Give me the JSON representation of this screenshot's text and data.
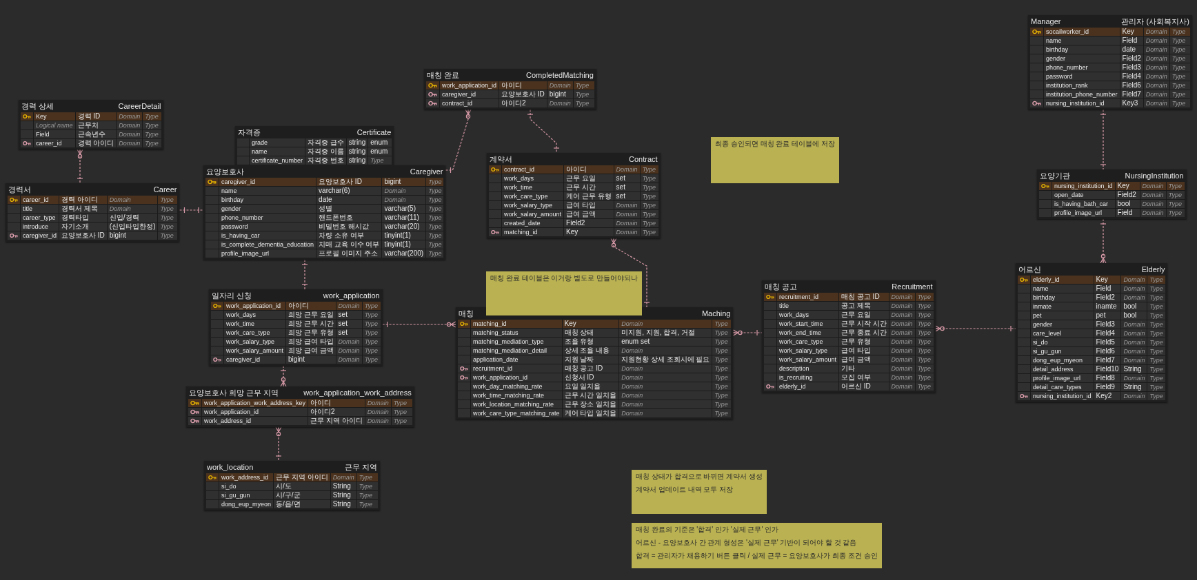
{
  "tables": [
    {
      "title_left": "경력 상세",
      "title_right": "CareerDetail",
      "rows": [
        {
          "kind": "primary_key",
          "cells": [
            "Key",
            "경력 ID",
            {
              "placeholder": "Domain"
            },
            {
              "placeholder": "Type"
            }
          ]
        },
        {
          "kind": "field",
          "cells": [
            {
              "placeholder": "Logical name"
            },
            "근무처",
            {
              "placeholder": "Domain"
            },
            {
              "placeholder": "Type"
            }
          ]
        },
        {
          "kind": "field",
          "cells": [
            "Field",
            "근속년수",
            {
              "placeholder": "Domain"
            },
            {
              "placeholder": "Type"
            }
          ]
        },
        {
          "kind": "foreign_key",
          "cells": [
            "career_id",
            "경력 아이디",
            {
              "placeholder": "Domain"
            },
            {
              "placeholder": "Type"
            }
          ]
        }
      ]
    },
    {
      "title_left": "경력서",
      "title_right": "Career",
      "rows": [
        {
          "kind": "primary_key",
          "cells": [
            "career_id",
            "경력 아이디",
            {
              "placeholder": "Domain"
            },
            {
              "placeholder": "Type"
            }
          ]
        },
        {
          "kind": "field",
          "cells": [
            "title",
            "경력서 제목",
            {
              "placeholder": "Domain"
            },
            {
              "placeholder": "Type"
            }
          ]
        },
        {
          "kind": "field",
          "cells": [
            "career_type",
            "경력타입",
            "신입/경력",
            {
              "placeholder": "Type"
            }
          ]
        },
        {
          "kind": "field",
          "cells": [
            "introduce",
            "자기소개",
            "(신입타입한정)",
            {
              "placeholder": "Type"
            }
          ]
        },
        {
          "kind": "foreign_key",
          "cells": [
            "caregiver_id",
            "요양보호사 ID",
            "bigint",
            {
              "placeholder": "Type"
            }
          ]
        }
      ]
    },
    {
      "title_left": "자격증",
      "title_right": "Certificate",
      "rows": [
        {
          "kind": "field",
          "cells": [
            "grade",
            "자격증 급수",
            "string",
            "enum"
          ]
        },
        {
          "kind": "field",
          "cells": [
            "name",
            "자격증 이름",
            "string",
            "enum"
          ]
        },
        {
          "kind": "field",
          "cells": [
            "certificate_number",
            "자격증 번호",
            "string",
            {
              "placeholder": "Type"
            }
          ]
        }
      ]
    },
    {
      "title_left": "요양보호사",
      "title_right": "Caregiver",
      "rows": [
        {
          "kind": "primary_key",
          "cells": [
            "caregiver_id",
            "요양보호사 ID",
            "bigint",
            {
              "placeholder": "Type"
            }
          ]
        },
        {
          "kind": "field",
          "cells": [
            "name",
            "varchar(6)",
            {
              "placeholder": "Domain"
            },
            {
              "placeholder": "Type"
            }
          ]
        },
        {
          "kind": "field",
          "cells": [
            "birthday",
            "date",
            {
              "placeholder": "Domain"
            },
            {
              "placeholder": "Type"
            }
          ]
        },
        {
          "kind": "field",
          "cells": [
            "gender",
            "성별",
            "varchar(5)",
            {
              "placeholder": "Type"
            }
          ]
        },
        {
          "kind": "field",
          "cells": [
            "phone_number",
            "핸드폰번호",
            "varchar(11)",
            {
              "placeholder": "Type"
            }
          ]
        },
        {
          "kind": "field",
          "cells": [
            "password",
            "비밀번호 해시값",
            "varchar(20)",
            {
              "placeholder": "Type"
            }
          ]
        },
        {
          "kind": "field",
          "cells": [
            "is_having_car",
            "차량 소유 여부",
            "tinyint(1)",
            {
              "placeholder": "Type"
            }
          ]
        },
        {
          "kind": "field",
          "cells": [
            "is_complete_dementia_education",
            "치매 교육 이수 여부",
            "tinyint(1)",
            {
              "placeholder": "Type"
            }
          ]
        },
        {
          "kind": "field",
          "cells": [
            "profile_image_url",
            "프로필 이미지 주소",
            "varchar(200)",
            {
              "placeholder": "Type"
            }
          ]
        }
      ]
    },
    {
      "title_left": "일자리 신청",
      "title_right": "work_application",
      "rows": [
        {
          "kind": "primary_key",
          "cells": [
            "work_application_id",
            "아이디",
            {
              "placeholder": "Domain"
            },
            {
              "placeholder": "Type"
            }
          ]
        },
        {
          "kind": "field",
          "cells": [
            "work_days",
            "희망 근무 요일",
            "set",
            {
              "placeholder": "Type"
            }
          ]
        },
        {
          "kind": "field",
          "cells": [
            "work_time",
            "희망 근무 시간",
            "set",
            {
              "placeholder": "Type"
            }
          ]
        },
        {
          "kind": "field",
          "cells": [
            "work_care_type",
            "희망 근무 유형",
            "set",
            {
              "placeholder": "Type"
            }
          ]
        },
        {
          "kind": "field",
          "cells": [
            "work_salary_type",
            "희망 급여 타입",
            {
              "placeholder": "Domain"
            },
            {
              "placeholder": "Type"
            }
          ]
        },
        {
          "kind": "field",
          "cells": [
            "work_salary_amount",
            "희망 급여 금액",
            {
              "placeholder": "Domain"
            },
            {
              "placeholder": "Type"
            }
          ]
        },
        {
          "kind": "foreign_key",
          "cells": [
            "caregiver_id",
            "bigint",
            {
              "placeholder": "Domain"
            },
            {
              "placeholder": "Type"
            }
          ]
        }
      ]
    },
    {
      "title_left": "요양보호사 희망 근무 지역",
      "title_right": "work_application_work_address",
      "rows": [
        {
          "kind": "primary_key",
          "cells": [
            "work_application_work_address_key",
            "아이디",
            {
              "placeholder": "Domain"
            },
            {
              "placeholder": "Type"
            }
          ]
        },
        {
          "kind": "foreign_key",
          "cells": [
            "work_application_id",
            "아이디2",
            {
              "placeholder": "Domain"
            },
            {
              "placeholder": "Type"
            }
          ]
        },
        {
          "kind": "foreign_key",
          "cells": [
            "work_address_id",
            "근무 지역 아이디",
            {
              "placeholder": "Domain"
            },
            {
              "placeholder": "Type"
            }
          ]
        }
      ]
    },
    {
      "title_left": "work_location",
      "title_right": "근무 지역",
      "rows": [
        {
          "kind": "primary_key",
          "cells": [
            "work_address_id",
            "근무 지역 아이디",
            {
              "placeholder": "Domain"
            },
            {
              "placeholder": "Type"
            }
          ]
        },
        {
          "kind": "field",
          "cells": [
            "si_do",
            "시/도",
            "String",
            {
              "placeholder": "Type"
            }
          ]
        },
        {
          "kind": "field",
          "cells": [
            "si_gu_gun",
            "시/구/군",
            "String",
            {
              "placeholder": "Type"
            }
          ]
        },
        {
          "kind": "field",
          "cells": [
            "dong_eup_myeon",
            "동/읍/면",
            "String",
            {
              "placeholder": "Type"
            }
          ]
        }
      ]
    },
    {
      "title_left": "매칭 완료",
      "title_right": "CompletedMatching",
      "rows": [
        {
          "kind": "primary_key",
          "cells": [
            "work_application_id",
            "아이디",
            {
              "placeholder": "Domain"
            },
            {
              "placeholder": "Type"
            }
          ]
        },
        {
          "kind": "foreign_key",
          "cells": [
            "caregiver_id",
            "요양보호사 ID",
            "bigint",
            {
              "placeholder": "Type"
            }
          ]
        },
        {
          "kind": "foreign_key",
          "cells": [
            "contract_id",
            "아이디2",
            {
              "placeholder": "Domain"
            },
            {
              "placeholder": "Type"
            }
          ]
        }
      ]
    },
    {
      "title_left": "계약서",
      "title_right": "Contract",
      "rows": [
        {
          "kind": "primary_key",
          "cells": [
            "contract_id",
            "아이디",
            {
              "placeholder": "Domain"
            },
            {
              "placeholder": "Type"
            }
          ]
        },
        {
          "kind": "field",
          "cells": [
            "work_days",
            "근무 요일",
            "set",
            {
              "placeholder": "Type"
            }
          ]
        },
        {
          "kind": "field",
          "cells": [
            "work_time",
            "근무 시간",
            "set",
            {
              "placeholder": "Type"
            }
          ]
        },
        {
          "kind": "field",
          "cells": [
            "work_care_type",
            "케어 근무 유형",
            "set",
            {
              "placeholder": "Type"
            }
          ]
        },
        {
          "kind": "field",
          "cells": [
            "work_salary_type",
            "급여 타입",
            {
              "placeholder": "Domain"
            },
            {
              "placeholder": "Type"
            }
          ]
        },
        {
          "kind": "field",
          "cells": [
            "work_salary_amount",
            "급여 금액",
            {
              "placeholder": "Domain"
            },
            {
              "placeholder": "Type"
            }
          ]
        },
        {
          "kind": "field",
          "cells": [
            "created_date",
            "Field2",
            {
              "placeholder": "Domain"
            },
            {
              "placeholder": "Type"
            }
          ]
        },
        {
          "kind": "foreign_key",
          "cells": [
            "matching_id",
            "Key",
            {
              "placeholder": "Domain"
            },
            {
              "placeholder": "Type"
            }
          ]
        }
      ]
    },
    {
      "title_left": "매칭",
      "title_right": "Maching",
      "rows": [
        {
          "kind": "primary_key",
          "cells": [
            "matching_id",
            "Key",
            {
              "placeholder": "Domain"
            },
            {
              "placeholder": "Type"
            }
          ]
        },
        {
          "kind": "field",
          "cells": [
            "matching_status",
            "매칭 상태",
            "미지원, 지원, 합격, 거절",
            {
              "placeholder": "Type"
            }
          ]
        },
        {
          "kind": "field",
          "cells": [
            "matching_mediation_type",
            "조율 유형",
            "enum set",
            {
              "placeholder": "Type"
            }
          ]
        },
        {
          "kind": "field",
          "cells": [
            "matching_mediation_detail",
            "상세 조율 내용",
            {
              "placeholder": "Domain"
            },
            {
              "placeholder": "Type"
            }
          ]
        },
        {
          "kind": "field",
          "cells": [
            "application_date",
            "지원 날짜",
            "지원현황 상세 조회시에 필요",
            {
              "placeholder": "Type"
            }
          ]
        },
        {
          "kind": "foreign_key",
          "cells": [
            "recruitment_id",
            "매칭 공고 ID",
            {
              "placeholder": "Domain"
            },
            {
              "placeholder": "Type"
            }
          ]
        },
        {
          "kind": "foreign_key",
          "cells": [
            "work_application_id",
            "신청서 ID",
            {
              "placeholder": "Domain"
            },
            {
              "placeholder": "Type"
            }
          ]
        },
        {
          "kind": "field",
          "cells": [
            "work_day_matching_rate",
            "요일 일치율",
            {
              "placeholder": "Domain"
            },
            {
              "placeholder": "Type"
            }
          ]
        },
        {
          "kind": "field",
          "cells": [
            "work_time_matching_rate",
            "근무 시간 일치율",
            {
              "placeholder": "Domain"
            },
            {
              "placeholder": "Type"
            }
          ]
        },
        {
          "kind": "field",
          "cells": [
            "work_location_matching_rate",
            "근무 장소 일치율",
            {
              "placeholder": "Domain"
            },
            {
              "placeholder": "Type"
            }
          ]
        },
        {
          "kind": "field",
          "cells": [
            "work_care_type_matching_rate",
            "케어 타입 일치율",
            {
              "placeholder": "Domain"
            },
            {
              "placeholder": "Type"
            }
          ]
        }
      ]
    },
    {
      "title_left": "매칭 공고",
      "title_right": "Recruitment",
      "rows": [
        {
          "kind": "primary_key",
          "cells": [
            "recruitment_id",
            "매칭 공고 ID",
            {
              "placeholder": "Domain"
            },
            {
              "placeholder": "Type"
            }
          ]
        },
        {
          "kind": "field",
          "cells": [
            "title",
            "공고 제목",
            {
              "placeholder": "Domain"
            },
            {
              "placeholder": "Type"
            }
          ]
        },
        {
          "kind": "field",
          "cells": [
            "work_days",
            "근무 요일",
            {
              "placeholder": "Domain"
            },
            {
              "placeholder": "Type"
            }
          ]
        },
        {
          "kind": "field",
          "cells": [
            "work_start_time",
            "근무 시작 시간",
            {
              "placeholder": "Domain"
            },
            {
              "placeholder": "Type"
            }
          ]
        },
        {
          "kind": "field",
          "cells": [
            "work_end_time",
            "근무 종료 시간",
            {
              "placeholder": "Domain"
            },
            {
              "placeholder": "Type"
            }
          ]
        },
        {
          "kind": "field",
          "cells": [
            "work_care_type",
            "근무 유형",
            {
              "placeholder": "Domain"
            },
            {
              "placeholder": "Type"
            }
          ]
        },
        {
          "kind": "field",
          "cells": [
            "work_salary_type",
            "급여 타입",
            {
              "placeholder": "Domain"
            },
            {
              "placeholder": "Type"
            }
          ]
        },
        {
          "kind": "field",
          "cells": [
            "work_salary_amount",
            "급여 금액",
            {
              "placeholder": "Domain"
            },
            {
              "placeholder": "Type"
            }
          ]
        },
        {
          "kind": "field",
          "cells": [
            "description",
            "기타",
            {
              "placeholder": "Domain"
            },
            {
              "placeholder": "Type"
            }
          ]
        },
        {
          "kind": "field",
          "cells": [
            "is_recruiting",
            "모집 여부",
            {
              "placeholder": "Domain"
            },
            {
              "placeholder": "Type"
            }
          ]
        },
        {
          "kind": "foreign_key",
          "cells": [
            "elderly_id",
            "어르신 ID",
            {
              "placeholder": "Domain"
            },
            {
              "placeholder": "Type"
            }
          ]
        }
      ]
    },
    {
      "title_left": "Manager",
      "title_right": "관리자 (사회복지사)",
      "rows": [
        {
          "kind": "primary_key",
          "cells": [
            "socailworker_id",
            "Key",
            {
              "placeholder": "Domain"
            },
            {
              "placeholder": "Type"
            }
          ]
        },
        {
          "kind": "field",
          "cells": [
            "name",
            "Field",
            {
              "placeholder": "Domain"
            },
            {
              "placeholder": "Type"
            }
          ]
        },
        {
          "kind": "field",
          "cells": [
            "birthday",
            "date",
            {
              "placeholder": "Domain"
            },
            {
              "placeholder": "Type"
            }
          ]
        },
        {
          "kind": "field",
          "cells": [
            "gender",
            "Field2",
            {
              "placeholder": "Domain"
            },
            {
              "placeholder": "Type"
            }
          ]
        },
        {
          "kind": "field",
          "cells": [
            "phone_number",
            "Field3",
            {
              "placeholder": "Domain"
            },
            {
              "placeholder": "Type"
            }
          ]
        },
        {
          "kind": "field",
          "cells": [
            "password",
            "Field4",
            {
              "placeholder": "Domain"
            },
            {
              "placeholder": "Type"
            }
          ]
        },
        {
          "kind": "field",
          "cells": [
            "institution_rank",
            "Field6",
            {
              "placeholder": "Domain"
            },
            {
              "placeholder": "Type"
            }
          ]
        },
        {
          "kind": "field",
          "cells": [
            "institution_phone_number",
            "Field7",
            {
              "placeholder": "Domain"
            },
            {
              "placeholder": "Type"
            }
          ]
        },
        {
          "kind": "foreign_key",
          "cells": [
            "nursing_institution_id",
            "Key3",
            {
              "placeholder": "Domain"
            },
            {
              "placeholder": "Type"
            }
          ]
        }
      ]
    },
    {
      "title_left": "요양기관",
      "title_right": "NursingInstitution",
      "rows": [
        {
          "kind": "primary_key",
          "cells": [
            "nursing_institution_id",
            "Key",
            {
              "placeholder": "Domain"
            },
            {
              "placeholder": "Type"
            }
          ]
        },
        {
          "kind": "field",
          "cells": [
            "open_date",
            "Field2",
            {
              "placeholder": "Domain"
            },
            {
              "placeholder": "Type"
            }
          ]
        },
        {
          "kind": "field",
          "cells": [
            "is_having_bath_car",
            "bool",
            {
              "placeholder": "Domain"
            },
            {
              "placeholder": "Type"
            }
          ]
        },
        {
          "kind": "field",
          "cells": [
            "profile_image_url",
            "Field",
            {
              "placeholder": "Domain"
            },
            {
              "placeholder": "Type"
            }
          ]
        }
      ]
    },
    {
      "title_left": "어르신",
      "title_right": "Elderly",
      "rows": [
        {
          "kind": "primary_key",
          "cells": [
            "elderly_id",
            "Key",
            {
              "placeholder": "Domain"
            },
            {
              "placeholder": "Type"
            }
          ]
        },
        {
          "kind": "field",
          "cells": [
            "name",
            "Field",
            {
              "placeholder": "Domain"
            },
            {
              "placeholder": "Type"
            }
          ]
        },
        {
          "kind": "field",
          "cells": [
            "birthday",
            "Field2",
            {
              "placeholder": "Domain"
            },
            {
              "placeholder": "Type"
            }
          ]
        },
        {
          "kind": "field",
          "cells": [
            "inmate",
            "inamte",
            "bool",
            {
              "placeholder": "Type"
            }
          ]
        },
        {
          "kind": "field",
          "cells": [
            "pet",
            "pet",
            "bool",
            {
              "placeholder": "Type"
            }
          ]
        },
        {
          "kind": "field",
          "cells": [
            "gender",
            "Field3",
            {
              "placeholder": "Domain"
            },
            {
              "placeholder": "Type"
            }
          ]
        },
        {
          "kind": "field",
          "cells": [
            "care_level",
            "Field4",
            {
              "placeholder": "Domain"
            },
            {
              "placeholder": "Type"
            }
          ]
        },
        {
          "kind": "field",
          "cells": [
            "si_do",
            "Field5",
            {
              "placeholder": "Domain"
            },
            {
              "placeholder": "Type"
            }
          ]
        },
        {
          "kind": "field",
          "cells": [
            "si_gu_gun",
            "Field6",
            {
              "placeholder": "Domain"
            },
            {
              "placeholder": "Type"
            }
          ]
        },
        {
          "kind": "field",
          "cells": [
            "dong_eup_myeon",
            "Field7",
            {
              "placeholder": "Domain"
            },
            {
              "placeholder": "Type"
            }
          ]
        },
        {
          "kind": "field",
          "cells": [
            "detail_address",
            "Field10",
            "String",
            {
              "placeholder": "Type"
            }
          ]
        },
        {
          "kind": "field",
          "cells": [
            "profile_image_url",
            "Field8",
            {
              "placeholder": "Domain"
            },
            {
              "placeholder": "Type"
            }
          ]
        },
        {
          "kind": "field",
          "cells": [
            "detail_care_types",
            "Field9",
            "String",
            {
              "placeholder": "Type"
            }
          ]
        },
        {
          "kind": "foreign_key",
          "cells": [
            "nursing_institution_id",
            "Key2",
            {
              "placeholder": "Domain"
            },
            {
              "placeholder": "Type"
            }
          ]
        }
      ]
    }
  ],
  "notes": [
    {
      "lines": [
        "매칭 완료 테이블은 이거랑 별도로 만들어야되나"
      ]
    },
    {
      "lines": [
        "매칭 상태가 합격으로 바뀌면 계약서 생성",
        "계약서 업데이트 내역 모두 저장"
      ]
    },
    {
      "lines": [
        "매칭 완료의 기준은 '합격' 인가 '실제 근무' 인가",
        "어르신 - 요양보호사 간 관계 형성은 '실제 근무' 기반이 되어야 할 것 같음",
        "합격 = 관리자가 채용하기 버튼 클릭 / 실제 근무 = 요양보호사가 최종 조건 승인"
      ]
    },
    {
      "lines": [
        "최종 승인되면 매칭 완료 테이블에 저장"
      ]
    }
  ]
}
